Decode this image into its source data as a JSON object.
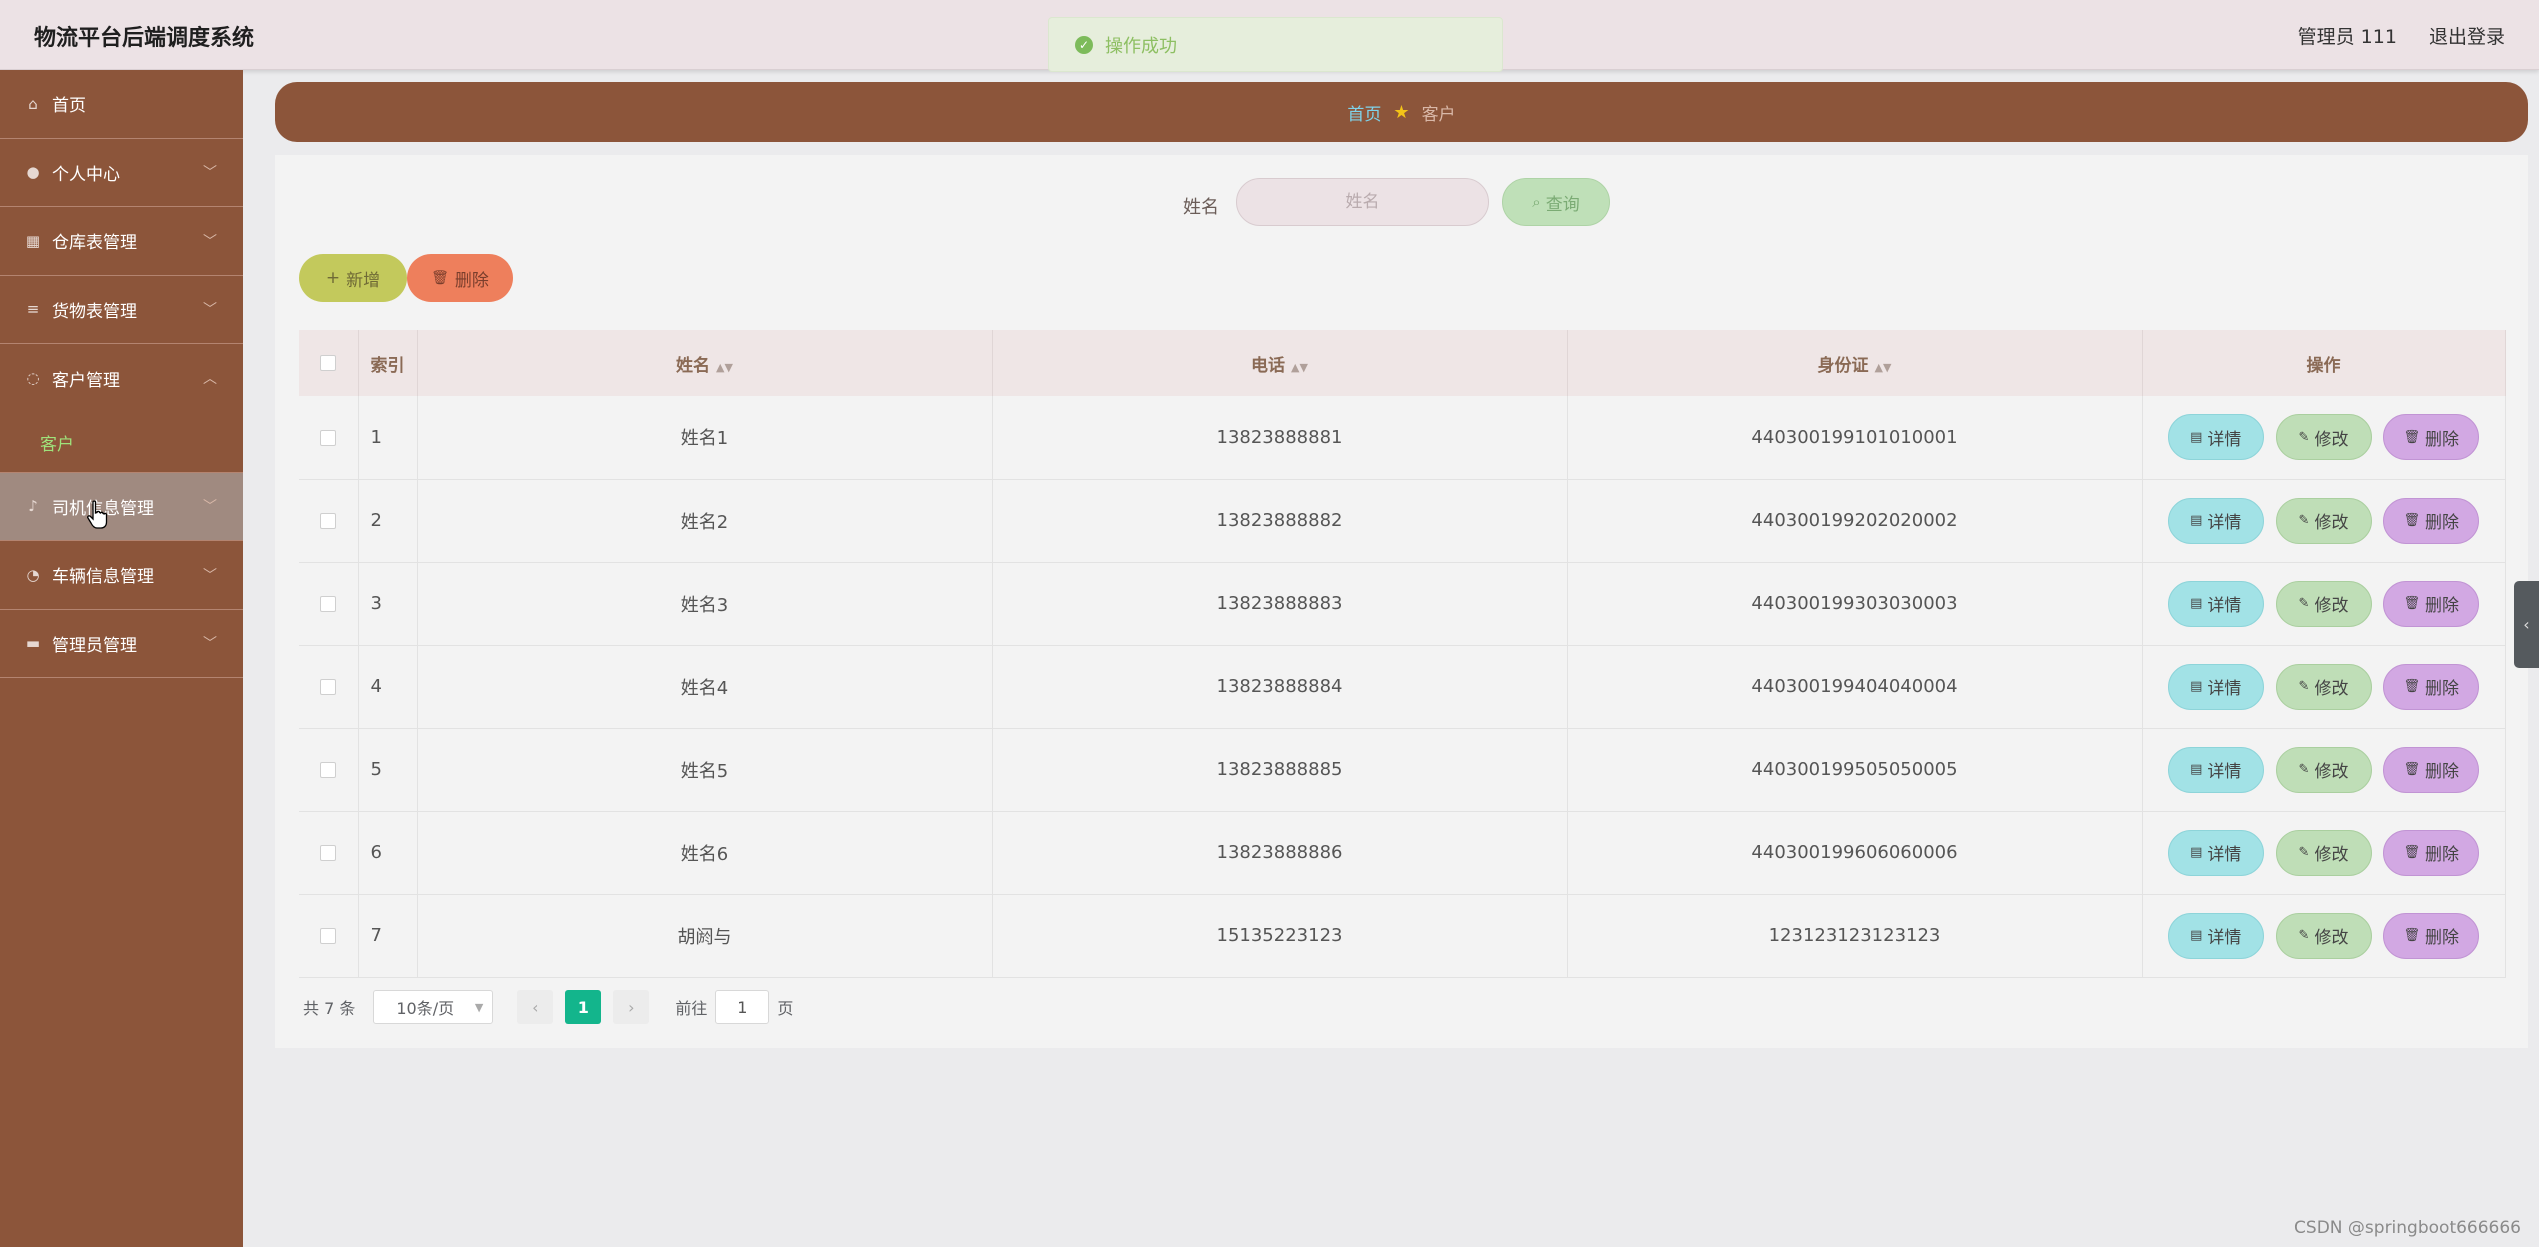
{
  "app": {
    "title": "物流平台后端调度系统"
  },
  "header": {
    "user": "管理员 111",
    "logout": "退出登录"
  },
  "toast": {
    "text": "操作成功"
  },
  "sidebar": {
    "items": [
      {
        "label": "首页",
        "icon": "home-icon"
      },
      {
        "label": "个人中心",
        "icon": "user-icon"
      },
      {
        "label": "仓库表管理",
        "icon": "grid-icon"
      },
      {
        "label": "货物表管理",
        "icon": "list-icon"
      },
      {
        "label": "客户管理",
        "icon": "globe-icon"
      },
      {
        "label": "司机信息管理",
        "icon": "mic-icon"
      },
      {
        "label": "车辆信息管理",
        "icon": "gauge-icon"
      },
      {
        "label": "管理员管理",
        "icon": "monitor-icon"
      }
    ],
    "submenu": {
      "label": "客户"
    }
  },
  "breadcrumb": {
    "home": "首页",
    "current": "客户"
  },
  "search": {
    "label": "姓名",
    "placeholder": "姓名",
    "button": "查询"
  },
  "actions": {
    "add": "新增",
    "delete": "删除"
  },
  "table": {
    "headers": {
      "index": "索引",
      "name": "姓名",
      "phone": "电话",
      "id_card": "身份证",
      "ops": "操作"
    },
    "op_labels": {
      "detail": "详情",
      "edit": "修改",
      "delete": "删除"
    },
    "rows": [
      {
        "index": "1",
        "name": "姓名1",
        "phone": "13823888881",
        "id_card": "440300199101010001"
      },
      {
        "index": "2",
        "name": "姓名2",
        "phone": "13823888882",
        "id_card": "440300199202020002"
      },
      {
        "index": "3",
        "name": "姓名3",
        "phone": "13823888883",
        "id_card": "440300199303030003"
      },
      {
        "index": "4",
        "name": "姓名4",
        "phone": "13823888884",
        "id_card": "440300199404040004"
      },
      {
        "index": "5",
        "name": "姓名5",
        "phone": "13823888885",
        "id_card": "440300199505050005"
      },
      {
        "index": "6",
        "name": "姓名6",
        "phone": "13823888886",
        "id_card": "440300199606060006"
      },
      {
        "index": "7",
        "name": "胡阏与",
        "phone": "15135223123",
        "id_card": "123123123123123"
      }
    ]
  },
  "pagination": {
    "total": "共 7 条",
    "page_size": "10条/页",
    "current": "1",
    "goto": "前往",
    "goto_value": "1",
    "page_suffix": "页"
  },
  "watermark": "CSDN @springboot666666",
  "colors": {
    "sidebar": "#8c553a",
    "accent_green": "#13b58c",
    "submenu_active": "#9fe27b"
  }
}
